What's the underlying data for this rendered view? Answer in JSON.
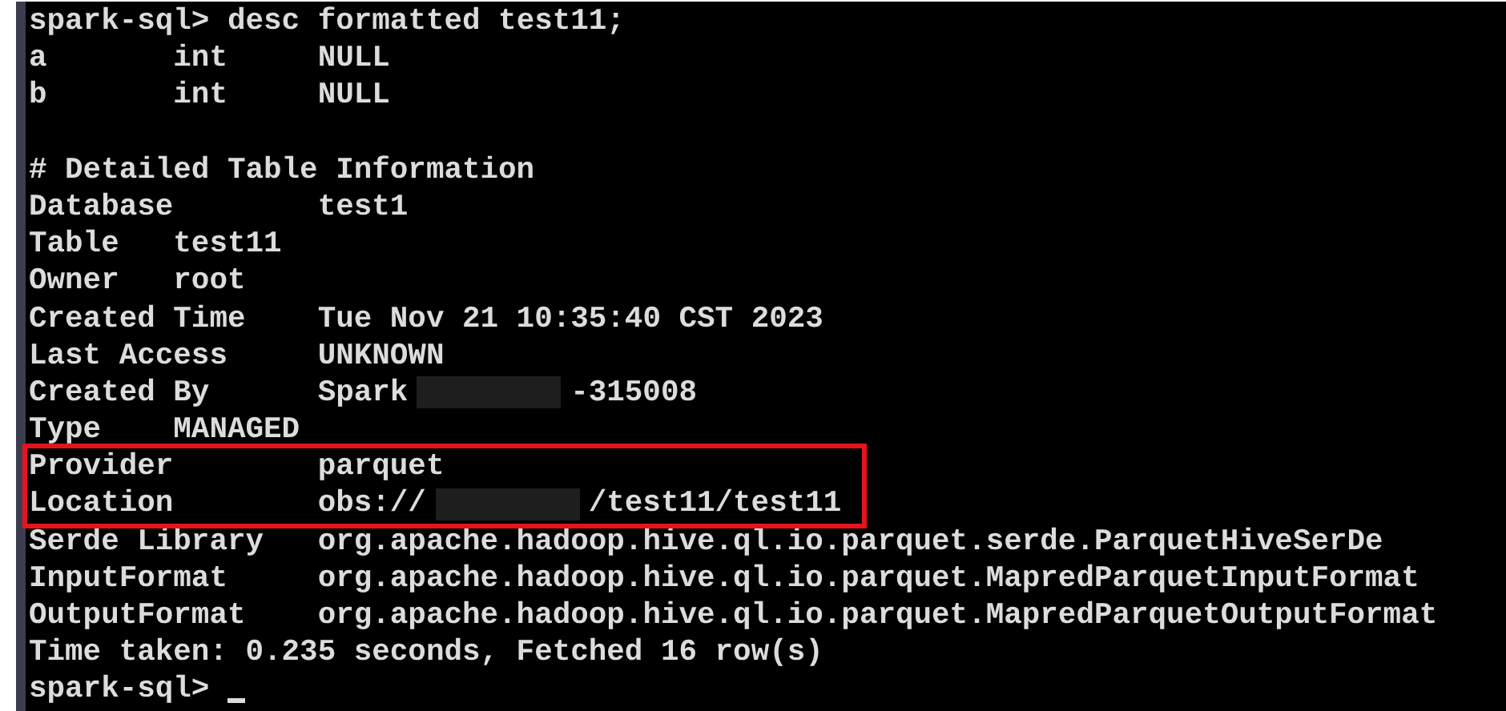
{
  "terminal": {
    "lines": [
      {
        "kind": "prompt",
        "prompt": "spark-sql>",
        "command": "desc formatted test11;",
        "highlighted": false
      },
      {
        "kind": "column",
        "cells": [
          "a",
          "int",
          "NULL"
        ],
        "highlighted": false
      },
      {
        "kind": "column",
        "cells": [
          "b",
          "int",
          "NULL"
        ],
        "highlighted": false
      },
      {
        "kind": "blank",
        "highlighted": false
      },
      {
        "kind": "plain",
        "text": "# Detailed Table Information",
        "highlighted": false
      },
      {
        "kind": "wide",
        "cells": [
          "Database",
          "test1"
        ],
        "highlighted": false
      },
      {
        "kind": "narrow",
        "cells": [
          "Table",
          "test11"
        ],
        "highlighted": false
      },
      {
        "kind": "narrow",
        "cells": [
          "Owner",
          "root"
        ],
        "highlighted": false
      },
      {
        "kind": "wide",
        "cells": [
          "Created Time",
          "Tue Nov 21 10:35:40 CST 2023"
        ],
        "highlighted": false
      },
      {
        "kind": "wide",
        "cells": [
          "Last Access",
          "UNKNOWN"
        ],
        "highlighted": false
      },
      {
        "kind": "wide",
        "cells": [
          "Created By",
          "Spark",
          {
            "kind": "redacted"
          },
          "-315008"
        ],
        "highlighted": false
      },
      {
        "kind": "narrow",
        "cells": [
          "Type",
          "MANAGED"
        ],
        "highlighted": false
      },
      {
        "kind": "wide",
        "cells": [
          "Provider",
          "parquet"
        ],
        "highlighted": true
      },
      {
        "kind": "wide",
        "cells": [
          "Location",
          "obs://",
          {
            "kind": "redacted"
          },
          "/test11/test11"
        ],
        "highlighted": true
      },
      {
        "kind": "wide",
        "cells": [
          "Serde Library",
          "org.apache.hadoop.hive.ql.io.parquet.serde.ParquetHiveSerDe"
        ],
        "highlighted": false
      },
      {
        "kind": "wide",
        "cells": [
          "InputFormat",
          "org.apache.hadoop.hive.ql.io.parquet.MapredParquetInputFormat"
        ],
        "highlighted": false
      },
      {
        "kind": "wide",
        "cells": [
          "OutputFormat",
          "org.apache.hadoop.hive.ql.io.parquet.MapredParquetOutputFormat"
        ],
        "highlighted": false
      },
      {
        "kind": "plain",
        "text": "Time taken: 0.235 seconds, Fetched 16 row(s)",
        "highlighted": false
      },
      {
        "kind": "prompt",
        "prompt": "spark-sql>",
        "cursor": true,
        "highlighted": false
      }
    ]
  }
}
